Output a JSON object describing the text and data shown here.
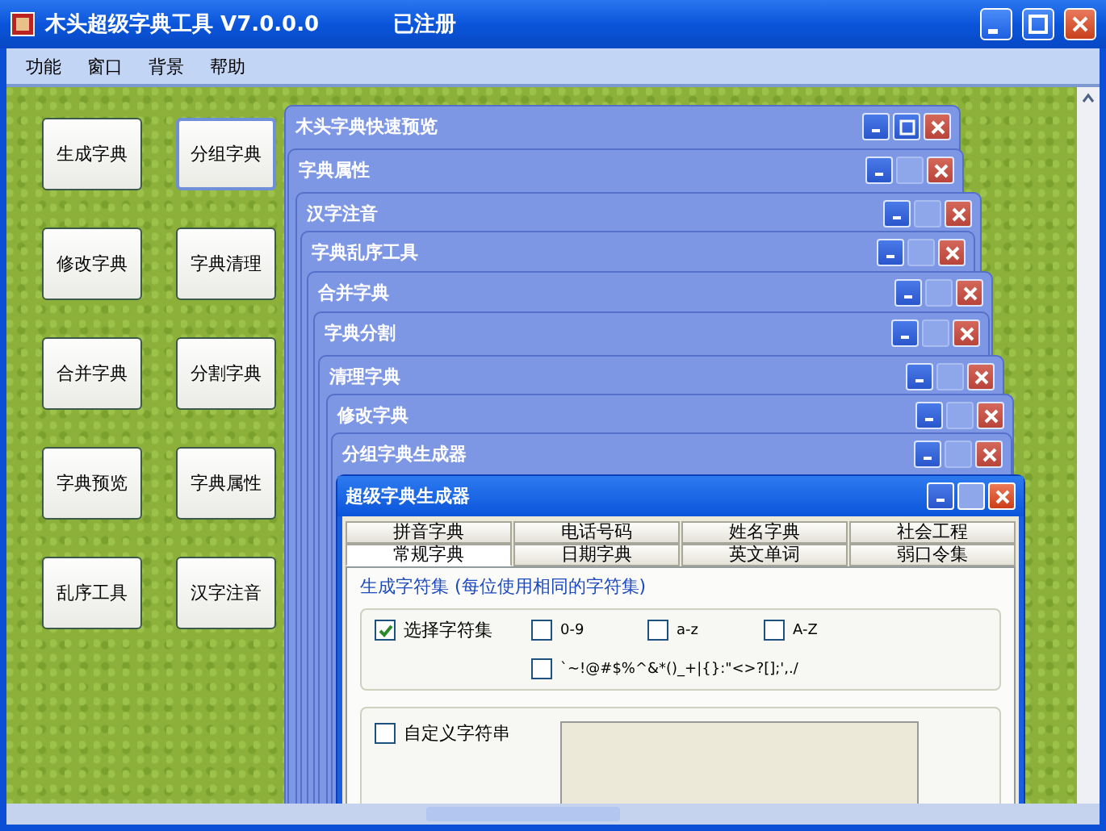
{
  "window": {
    "title": "木头超级字典工具 V7.0.0.0",
    "status": "已注册"
  },
  "menu": [
    "功能",
    "窗口",
    "背景",
    "帮助"
  ],
  "buttons": [
    {
      "label": "生成字典",
      "focused": false
    },
    {
      "label": "分组字典",
      "focused": true
    },
    {
      "label": "修改字典",
      "focused": false
    },
    {
      "label": "字典清理",
      "focused": false
    },
    {
      "label": "合并字典",
      "focused": false
    },
    {
      "label": "分割字典",
      "focused": false
    },
    {
      "label": "字典预览",
      "focused": false
    },
    {
      "label": "字典属性",
      "focused": false
    },
    {
      "label": "乱序工具",
      "focused": false
    },
    {
      "label": "汉字注音",
      "focused": false
    }
  ],
  "child_windows": [
    {
      "title": "木头字典快速预览",
      "maximize_enabled": true,
      "active": false
    },
    {
      "title": "字典属性",
      "maximize_enabled": false,
      "active": false
    },
    {
      "title": "汉字注音",
      "maximize_enabled": false,
      "active": false
    },
    {
      "title": "字典乱序工具",
      "maximize_enabled": false,
      "active": false
    },
    {
      "title": "合并字典",
      "maximize_enabled": false,
      "active": false
    },
    {
      "title": "字典分割",
      "maximize_enabled": false,
      "active": false
    },
    {
      "title": "清理字典",
      "maximize_enabled": false,
      "active": false
    },
    {
      "title": "修改字典",
      "maximize_enabled": false,
      "active": false
    },
    {
      "title": "分组字典生成器",
      "maximize_enabled": false,
      "active": false
    },
    {
      "title": "超级字典生成器",
      "maximize_enabled": false,
      "active": true
    }
  ],
  "generator": {
    "tab_rows": [
      [
        {
          "label": "拼音字典",
          "selected": false
        },
        {
          "label": "电话号码",
          "selected": false
        },
        {
          "label": "姓名字典",
          "selected": false
        },
        {
          "label": "社会工程",
          "selected": false
        }
      ],
      [
        {
          "label": "常规字典",
          "selected": true
        },
        {
          "label": "日期字典",
          "selected": false
        },
        {
          "label": "英文单词",
          "selected": false
        },
        {
          "label": "弱口令集",
          "selected": false
        }
      ]
    ],
    "charset_group": {
      "title": "生成字符集 (每位使用相同的字符集)",
      "options": [
        {
          "label": "选择字符集",
          "checked": true
        },
        {
          "label": "0-9",
          "checked": false
        },
        {
          "label": "a-z",
          "checked": false
        },
        {
          "label": "A-Z",
          "checked": false
        },
        {
          "label": "`~!@#$%^&*()_+|{}:\"<>?[];',./",
          "checked": false
        }
      ]
    },
    "custom": {
      "label": "自定义字符串",
      "checked": false
    }
  }
}
